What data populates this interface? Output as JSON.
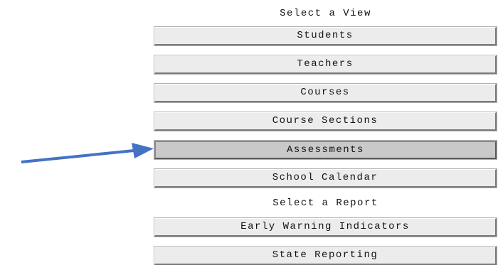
{
  "views": {
    "heading": "Select a View",
    "items": [
      {
        "label": "Students"
      },
      {
        "label": "Teachers"
      },
      {
        "label": "Courses"
      },
      {
        "label": "Course Sections"
      },
      {
        "label": "Assessments"
      },
      {
        "label": "School Calendar"
      }
    ]
  },
  "reports": {
    "heading": "Select a Report",
    "items": [
      {
        "label": "Early Warning Indicators"
      },
      {
        "label": "State Reporting"
      }
    ]
  },
  "annotation": {
    "arrow_color": "#4472c4",
    "arrow_target": "Assessments"
  }
}
